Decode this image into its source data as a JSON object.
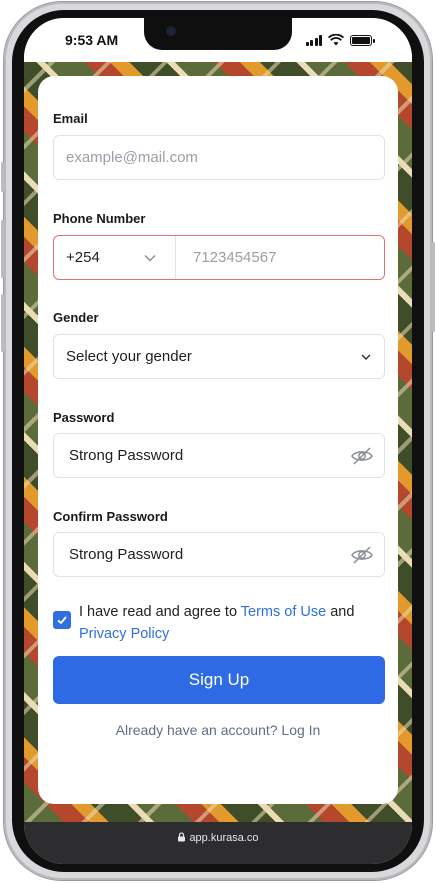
{
  "status_bar": {
    "time": "9:53 AM"
  },
  "form": {
    "email": {
      "label": "Email",
      "placeholder": "example@mail.com"
    },
    "phone": {
      "label": "Phone Number",
      "country_code": "+254",
      "placeholder": "7123454567"
    },
    "gender": {
      "label": "Gender",
      "selected": "Select your gender"
    },
    "password": {
      "label": "Password",
      "value": "Strong Password"
    },
    "confirm_password": {
      "label": "Confirm Password",
      "value": "Strong Password"
    },
    "terms": {
      "checked": true,
      "prefix": "I have read and agree to ",
      "terms_link": "Terms of Use",
      "middle": " and ",
      "privacy_link": "Privacy Policy"
    },
    "submit_label": "Sign Up",
    "login_prompt": "Already have an account? Log In"
  },
  "browser": {
    "url": "app.kurasa.co"
  },
  "colors": {
    "primary": "#2d6ae3",
    "link": "#2f6fe0",
    "error_border": "#e2727a"
  }
}
